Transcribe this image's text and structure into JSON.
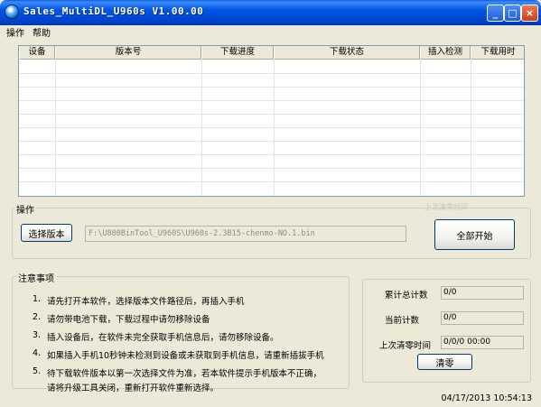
{
  "window": {
    "title": "Sales_MultiDL_U960s V1.00.00",
    "minimize_label": "_",
    "maximize_label": "□",
    "close_label": "×"
  },
  "menu": {
    "items": [
      "操作",
      "帮助"
    ]
  },
  "table": {
    "columns": [
      "设备",
      "版本号",
      "下载进度",
      "下载状态",
      "插入检测",
      "下载用时"
    ],
    "rows": []
  },
  "operation": {
    "group_title": "操作",
    "select_version_label": "选择版本",
    "path_value": "F:\\U880BinTool_U960S\\U960s-2.3B15-chenmo-NO.1.bin",
    "start_all_label": "全部开始",
    "faint_text": "上次清零时间"
  },
  "notes": {
    "group_title": "注意事项",
    "items": [
      "请先打开本软件，选择版本文件路径后，再插入手机",
      "请勿带电池下载，下载过程中请勿移除设备",
      "插入设备后，在软件未完全获取手机信息后，请勿移除设备。",
      "如果插入手机10秒钟未检测到设备或未获取到手机信息，请重新插拔手机",
      "待下载软件版本以第一次选择文件为准，若本软件提示手机版本不正确， "
    ],
    "item5_line2": "请将升级工具关闭，重新打开软件重新选择。",
    "numbers": [
      "1.",
      "2.",
      "3.",
      "4.",
      "5."
    ]
  },
  "counters": {
    "total_label": "累计总计数",
    "total_value": "0/0",
    "current_label": "当前计数",
    "current_value": "0/0",
    "last_reset_label": "上次清零时间",
    "last_reset_value": "0/0/0 00:00",
    "reset_label": "清零"
  },
  "status": {
    "timestamp": "04/17/2013 10:54:13"
  }
}
